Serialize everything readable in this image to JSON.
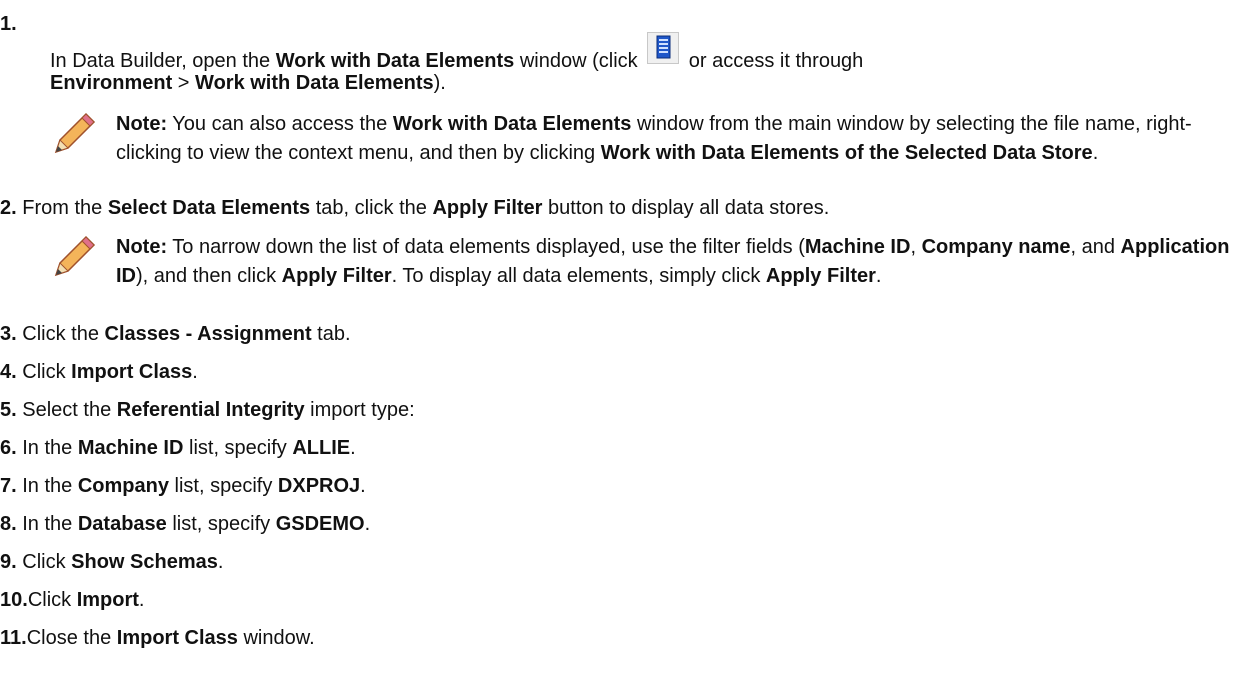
{
  "steps": [
    {
      "num": "1."
    },
    {
      "num": "2.",
      "t1": "From the ",
      "b1": "Select Data Elements",
      "t2": " tab, click the ",
      "b2": "Apply Filter",
      "t3": " button to display all data stores."
    },
    {
      "num": "3.",
      "t1": "Click the ",
      "b1": "Classes - Assignment",
      "t2": " tab."
    },
    {
      "num": "4.",
      "t1": "Click ",
      "b1": "Import Class",
      "t2": "."
    },
    {
      "num": "5.",
      "t1": "Select the ",
      "b1": "Referential Integrity",
      "t2": " import type:"
    },
    {
      "num": "6.",
      "t1": "In the ",
      "b1": "Machine ID",
      "t2": " list, specify ",
      "b2": "ALLIE",
      "t3": "."
    },
    {
      "num": "7.",
      "t1": "In the ",
      "b1": "Company",
      "t2": " list, specify ",
      "b2": "DXPROJ",
      "t3": "."
    },
    {
      "num": "8.",
      "t1": "In the ",
      "b1": "Database",
      "t2": " list, specify ",
      "b2": "GSDEMO",
      "t3": "."
    },
    {
      "num": "9.",
      "t1": "Click ",
      "b1": "Show Schemas",
      "t2": "."
    },
    {
      "num": "10.",
      "t1": "Click ",
      "b1": "Import",
      "t2": "."
    },
    {
      "num": "11.",
      "t1": "Close the ",
      "b1": "Import Class",
      "t2": " window."
    }
  ],
  "step1": {
    "t1": "In Data Builder, open the ",
    "b1": "Work with Data Elements",
    "t2": " window (click ",
    "t3": " or access it through",
    "b2": "Environment",
    "t4": " > ",
    "b3": "Work with Data Elements",
    "t5": ")."
  },
  "note1": {
    "label": "Note:",
    "t1": " You can also access the ",
    "b1": "Work with Data Elements",
    "t2": " window from the main window by selecting the file name, right-clicking to view the context menu, and then by clicking ",
    "b2": "Work with Data Elements of the Selected Data Store",
    "t3": "."
  },
  "note2": {
    "label": "Note:",
    "t1": " To narrow down the list of data elements displayed, use the filter fields (",
    "b1": "Machine ID",
    "t2": ", ",
    "b2": "Company name",
    "t3": ", and ",
    "b3": "Application ID",
    "t4": "), and then click ",
    "b4": "Apply Filter",
    "t5": ". To display all data elements, simply click ",
    "b5": "Apply Filter",
    "t6": "."
  },
  "icons": {
    "data_elements": "data-elements-window-icon",
    "note": "pencil-note-icon"
  }
}
